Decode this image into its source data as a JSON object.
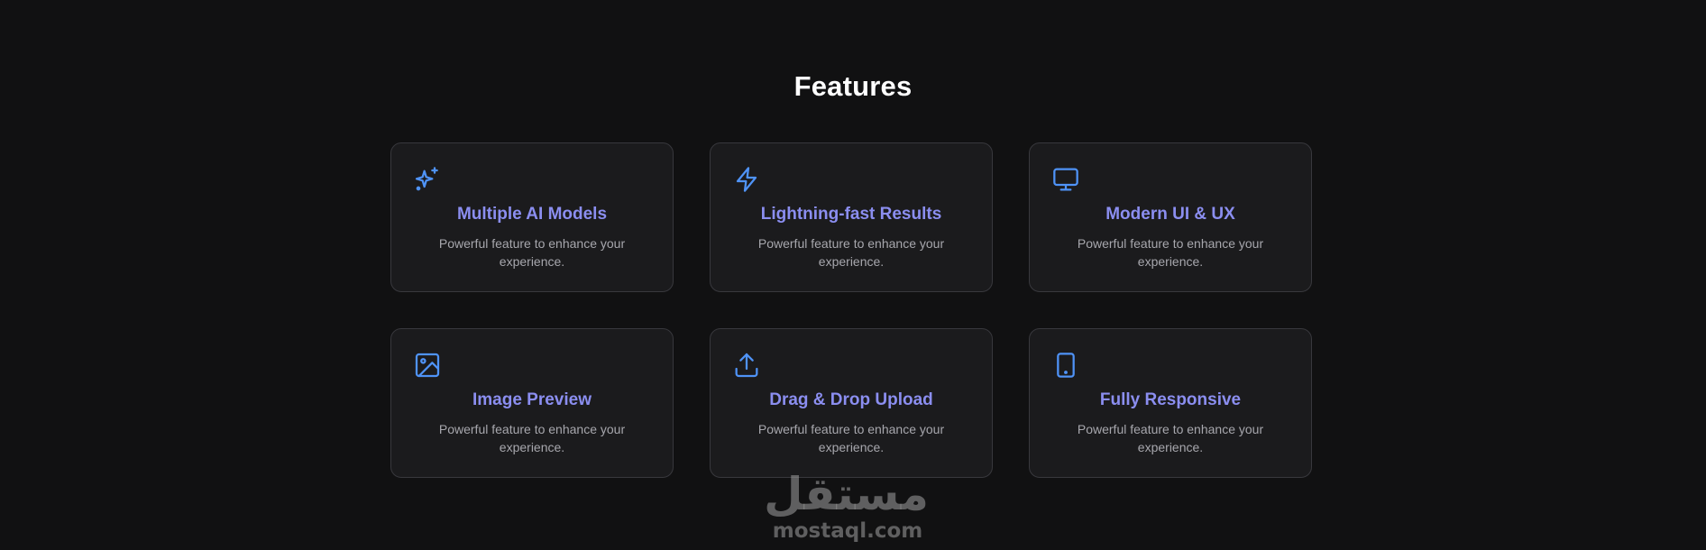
{
  "section": {
    "title": "Features"
  },
  "features": [
    {
      "title": "Multiple AI Models",
      "description": "Powerful feature to enhance your experience.",
      "icon": "sparkles-icon"
    },
    {
      "title": "Lightning-fast Results",
      "description": "Powerful feature to enhance your experience.",
      "icon": "lightning-icon"
    },
    {
      "title": "Modern UI & UX",
      "description": "Powerful feature to enhance your experience.",
      "icon": "monitor-icon"
    },
    {
      "title": "Image Preview",
      "description": "Powerful feature to enhance your experience.",
      "icon": "image-icon"
    },
    {
      "title": "Drag & Drop Upload",
      "description": "Powerful feature to enhance your experience.",
      "icon": "upload-icon"
    },
    {
      "title": "Fully Responsive",
      "description": "Powerful feature to enhance your experience.",
      "icon": "tablet-icon"
    }
  ],
  "watermark": {
    "arabic": "مستقل",
    "latin": "mostaql.com"
  },
  "colors": {
    "background": "#111112",
    "card_background": "#1b1b1d",
    "card_border": "#38383d",
    "accent_title": "#8b8ef0",
    "icon": "#4f93f7",
    "description": "#a7a7ad"
  }
}
